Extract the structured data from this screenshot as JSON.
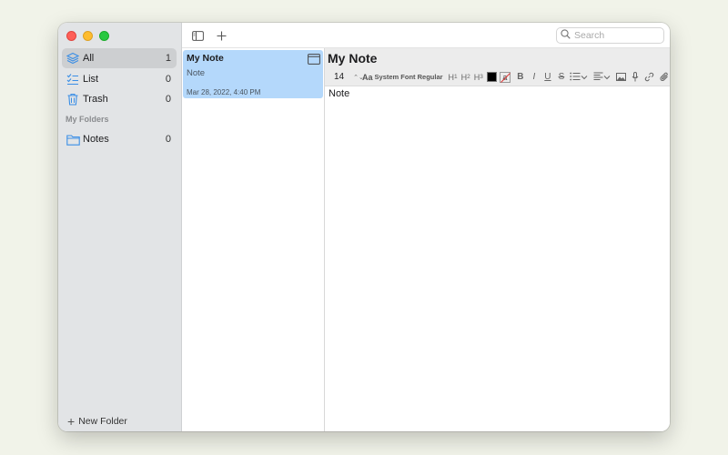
{
  "sidebar": {
    "items": [
      {
        "label": "All",
        "count": "1",
        "icon": "layers-icon"
      },
      {
        "label": "List",
        "count": "0",
        "icon": "checklist-icon"
      },
      {
        "label": "Trash",
        "count": "0",
        "icon": "trash-icon"
      }
    ],
    "section_title": "My Folders",
    "folders": [
      {
        "label": "Notes",
        "count": "0",
        "icon": "folder-icon"
      }
    ],
    "new_folder_label": "New Folder"
  },
  "toolbar": {
    "search_placeholder": "Search"
  },
  "notes_list": {
    "notes": [
      {
        "title": "My Note",
        "preview": "Note",
        "date": "Mar 28, 2022, 4:40 PM"
      }
    ]
  },
  "editor": {
    "title": "My Note",
    "font_size": "14",
    "font_size_arrows": "⌃⌄",
    "font_aa": "Aa",
    "font_name": "System Font Regular",
    "heading1": "H",
    "heading1_sub": "1",
    "heading2": "H",
    "heading2_sub": "2",
    "heading3": "H",
    "heading3_sub": "3",
    "text_color": "#000000",
    "highlight_glyph": "a",
    "bold": "B",
    "italic": "I",
    "underline": "U",
    "strike": "S",
    "body": "Note"
  },
  "colors": {
    "selection": "#b4d8fb",
    "sidebar_bg": "#e2e4e6",
    "accent_icon": "#3a8ee6"
  }
}
